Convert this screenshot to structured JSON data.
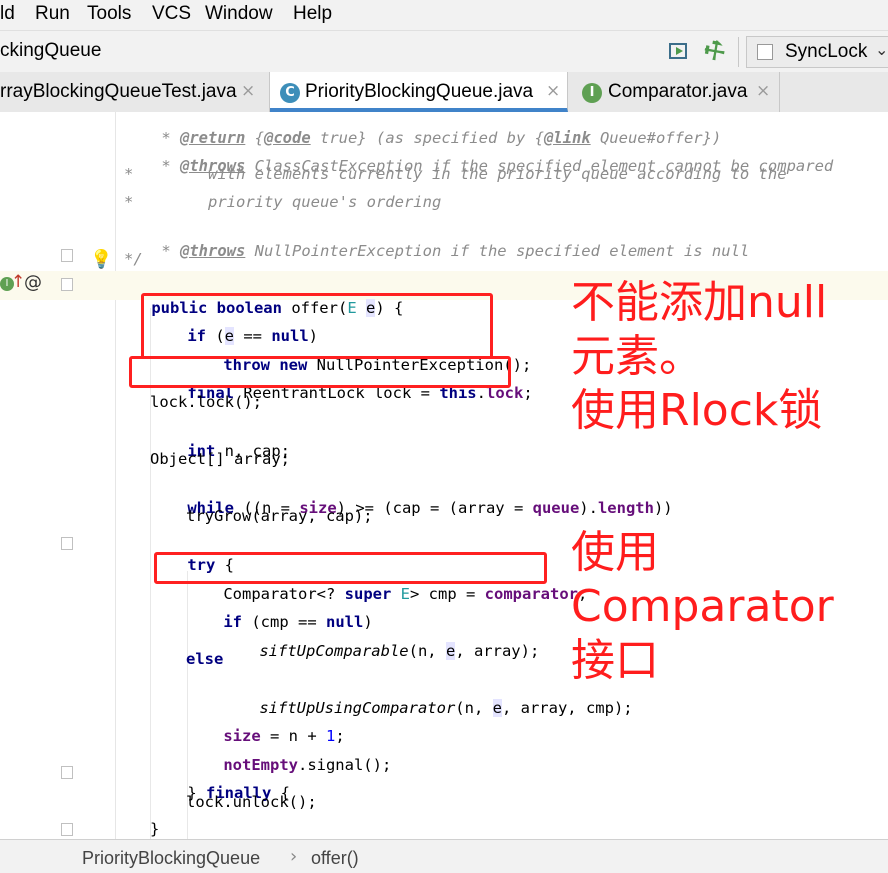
{
  "menu": [
    "ld",
    "Run",
    "Tools",
    "VCS",
    "Window",
    "Help"
  ],
  "nav": {
    "title": "ckingQueue",
    "run_config": "SyncLock"
  },
  "tabs": [
    {
      "label": "rrayBlockingQueueTest.java",
      "close": "×",
      "icon": ""
    },
    {
      "label": "PriorityBlockingQueue.java",
      "close": "×",
      "icon": "C"
    },
    {
      "label": "Comparator.java",
      "close": "×",
      "icon": "I"
    }
  ],
  "code": {
    "l0": [
      "* ",
      "@return",
      " {",
      "@code",
      " true} (as specified by {",
      "@link",
      " Queue#offer})"
    ],
    "l1": [
      "* ",
      "@throws",
      " ClassCastException if the specified element cannot be compared"
    ],
    "l2": "*        with elements currently in the priority queue according to the",
    "l3": "*        priority queue's ordering",
    "l4": [
      "* ",
      "@throws",
      " NullPointerException if the specified element is null"
    ],
    "l5": "*/",
    "l6": [
      "public boolean",
      " offer(",
      "E",
      " ",
      "e",
      ") {"
    ],
    "l7": [
      "if",
      " (",
      "e",
      " == ",
      "null",
      ")"
    ],
    "l8": [
      "throw new",
      " NullPointerException();"
    ],
    "l9": [
      "final",
      " ReentrantLock lock = ",
      "this",
      ".",
      "lock",
      ";"
    ],
    "l10": "lock.lock();",
    "l11": [
      "int",
      " n, cap;"
    ],
    "l12": "Object[] array;",
    "l13": [
      "while",
      " ((n = ",
      "size",
      ") >= (cap = (array = ",
      "queue",
      ").",
      "length",
      "))"
    ],
    "l14": "tryGrow(array, cap);",
    "l15": [
      "try",
      " {"
    ],
    "l16": [
      "Comparator<? ",
      "super",
      " ",
      "E",
      "> cmp = ",
      "comparator",
      ";"
    ],
    "l17": [
      "if",
      " (cmp == ",
      "null",
      ")"
    ],
    "l18": [
      "siftUpComparable",
      "(n, ",
      "e",
      ", array);"
    ],
    "l19": "else",
    "l20": [
      "siftUpUsingComparator",
      "(n, ",
      "e",
      ", array, cmp);"
    ],
    "l21": [
      "size",
      " = n + ",
      "1",
      ";"
    ],
    "l22": [
      "notEmpty",
      ".signal();"
    ],
    "l23": [
      "} ",
      "finally",
      " {"
    ],
    "l24": "lock.unlock();",
    "l25": "}"
  },
  "annotations": {
    "a1": [
      "不能添加null",
      "元素。",
      "使用Rlock锁"
    ],
    "a2": [
      "使用",
      "Comparator",
      "接口"
    ]
  },
  "status": {
    "breadcrumb_class": "PriorityBlockingQueue",
    "separator": "›",
    "breadcrumb_method": "offer()"
  },
  "colors": {
    "annotation": "#ff1d1d",
    "keyword": "#000080",
    "field": "#660e7a",
    "active_tab": "#4083c9"
  }
}
